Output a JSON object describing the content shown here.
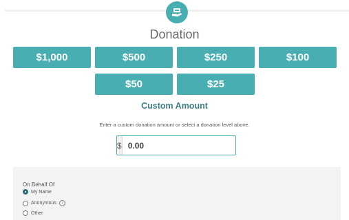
{
  "form": {
    "title": "Donation",
    "amounts": [
      "$1,000",
      "$500",
      "$250",
      "$100",
      "$50",
      "$25"
    ],
    "custom_title": "Custom Amount",
    "custom_description": "Enter a custom donation amount or select a donation level above.",
    "currency_symbol": "$",
    "custom_value": "0.00"
  },
  "behalf": {
    "label": "On Behalf Of",
    "options": [
      "My Name",
      "Anonymous",
      "Other"
    ],
    "selected": "My Name"
  },
  "colors": {
    "accent": "#49aeb1",
    "accent_dark": "#3f7f86",
    "panel_bg": "#f3f3f3"
  }
}
